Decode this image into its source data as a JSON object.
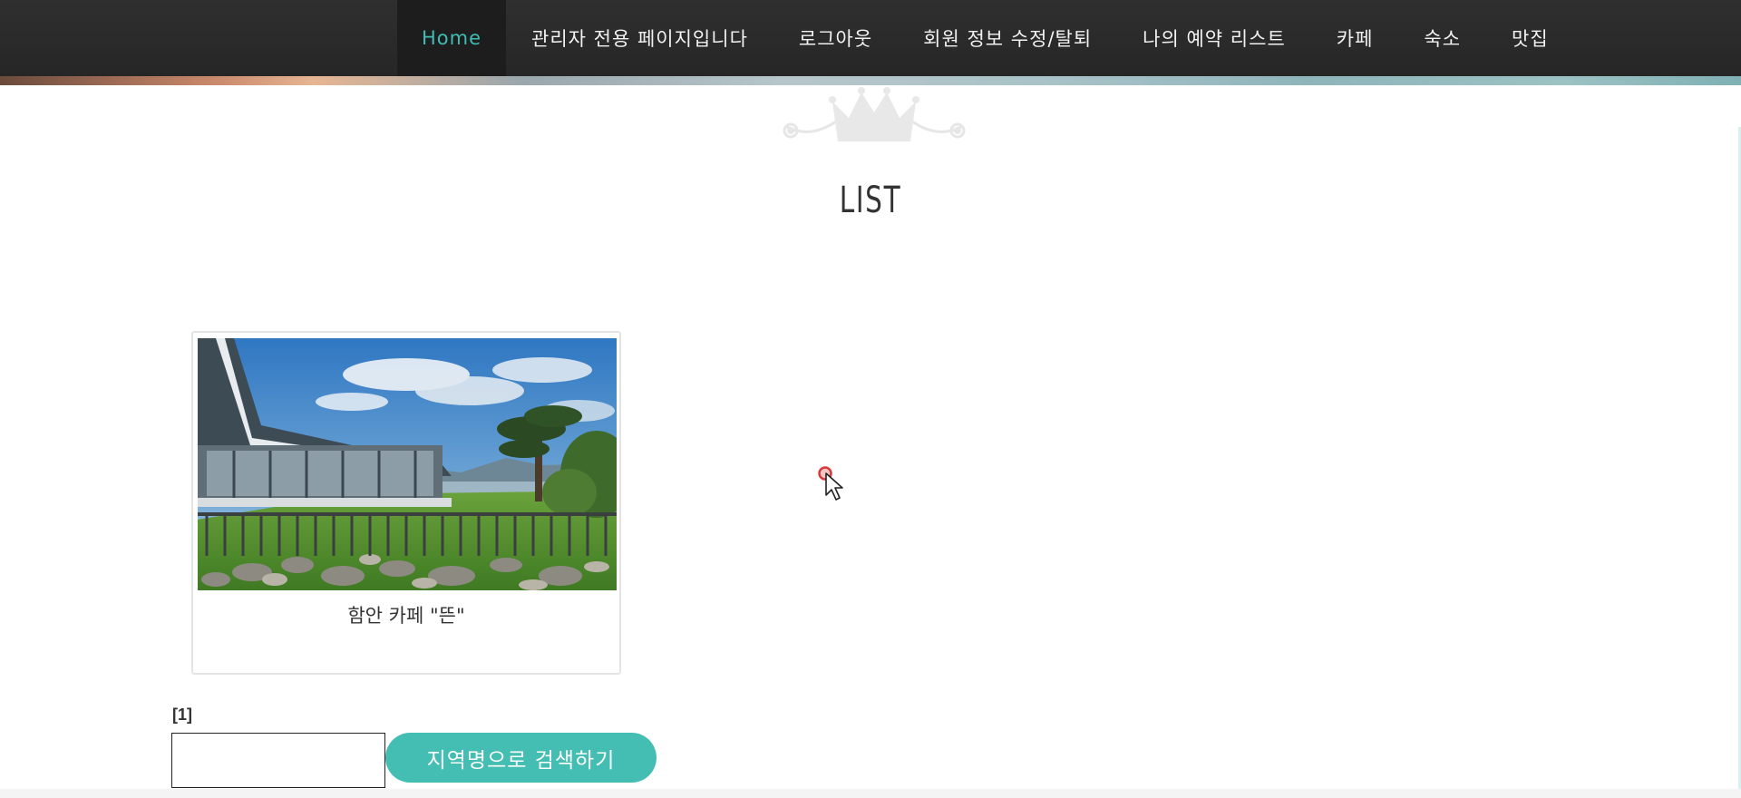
{
  "nav": {
    "items": [
      {
        "label": "Home",
        "active": true
      },
      {
        "label": "관리자 전용 페이지입니다",
        "active": false
      },
      {
        "label": "로그아웃",
        "active": false
      },
      {
        "label": "회원 정보 수정/탈퇴",
        "active": false
      },
      {
        "label": "나의 예약 리스트",
        "active": false
      },
      {
        "label": "카페",
        "active": false
      },
      {
        "label": "숙소",
        "active": false
      },
      {
        "label": "맛집",
        "active": false
      }
    ]
  },
  "page": {
    "title": "LIST"
  },
  "cards": [
    {
      "caption": "함안 카페 \"뜬\""
    }
  ],
  "pager": {
    "indicator": "[1]"
  },
  "search": {
    "value": "",
    "button_label": "지역명으로 검색하기"
  },
  "icons": {
    "ornament": "crown-icon",
    "pointer": "mouse-cursor-icon"
  },
  "colors": {
    "accent": "#44bdb2",
    "nav_bg": "#2f2f2f",
    "nav_active_text": "#3fbdb2"
  }
}
